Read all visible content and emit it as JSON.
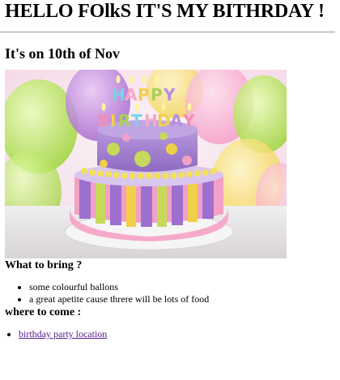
{
  "header": {
    "title": "HELLO FOlkS IT'S MY BITHRDAY !"
  },
  "subtitle": "It's on 10th of Nov",
  "image": {
    "topper_text": "HAPPY BIRTHDAY"
  },
  "bring_section": {
    "heading": "What to bring ?",
    "items": [
      "some colourful ballons",
      "a great apetite cause threre will be lots of food"
    ]
  },
  "where_section": {
    "heading": "where to come :",
    "link_label": "birthday party location"
  }
}
